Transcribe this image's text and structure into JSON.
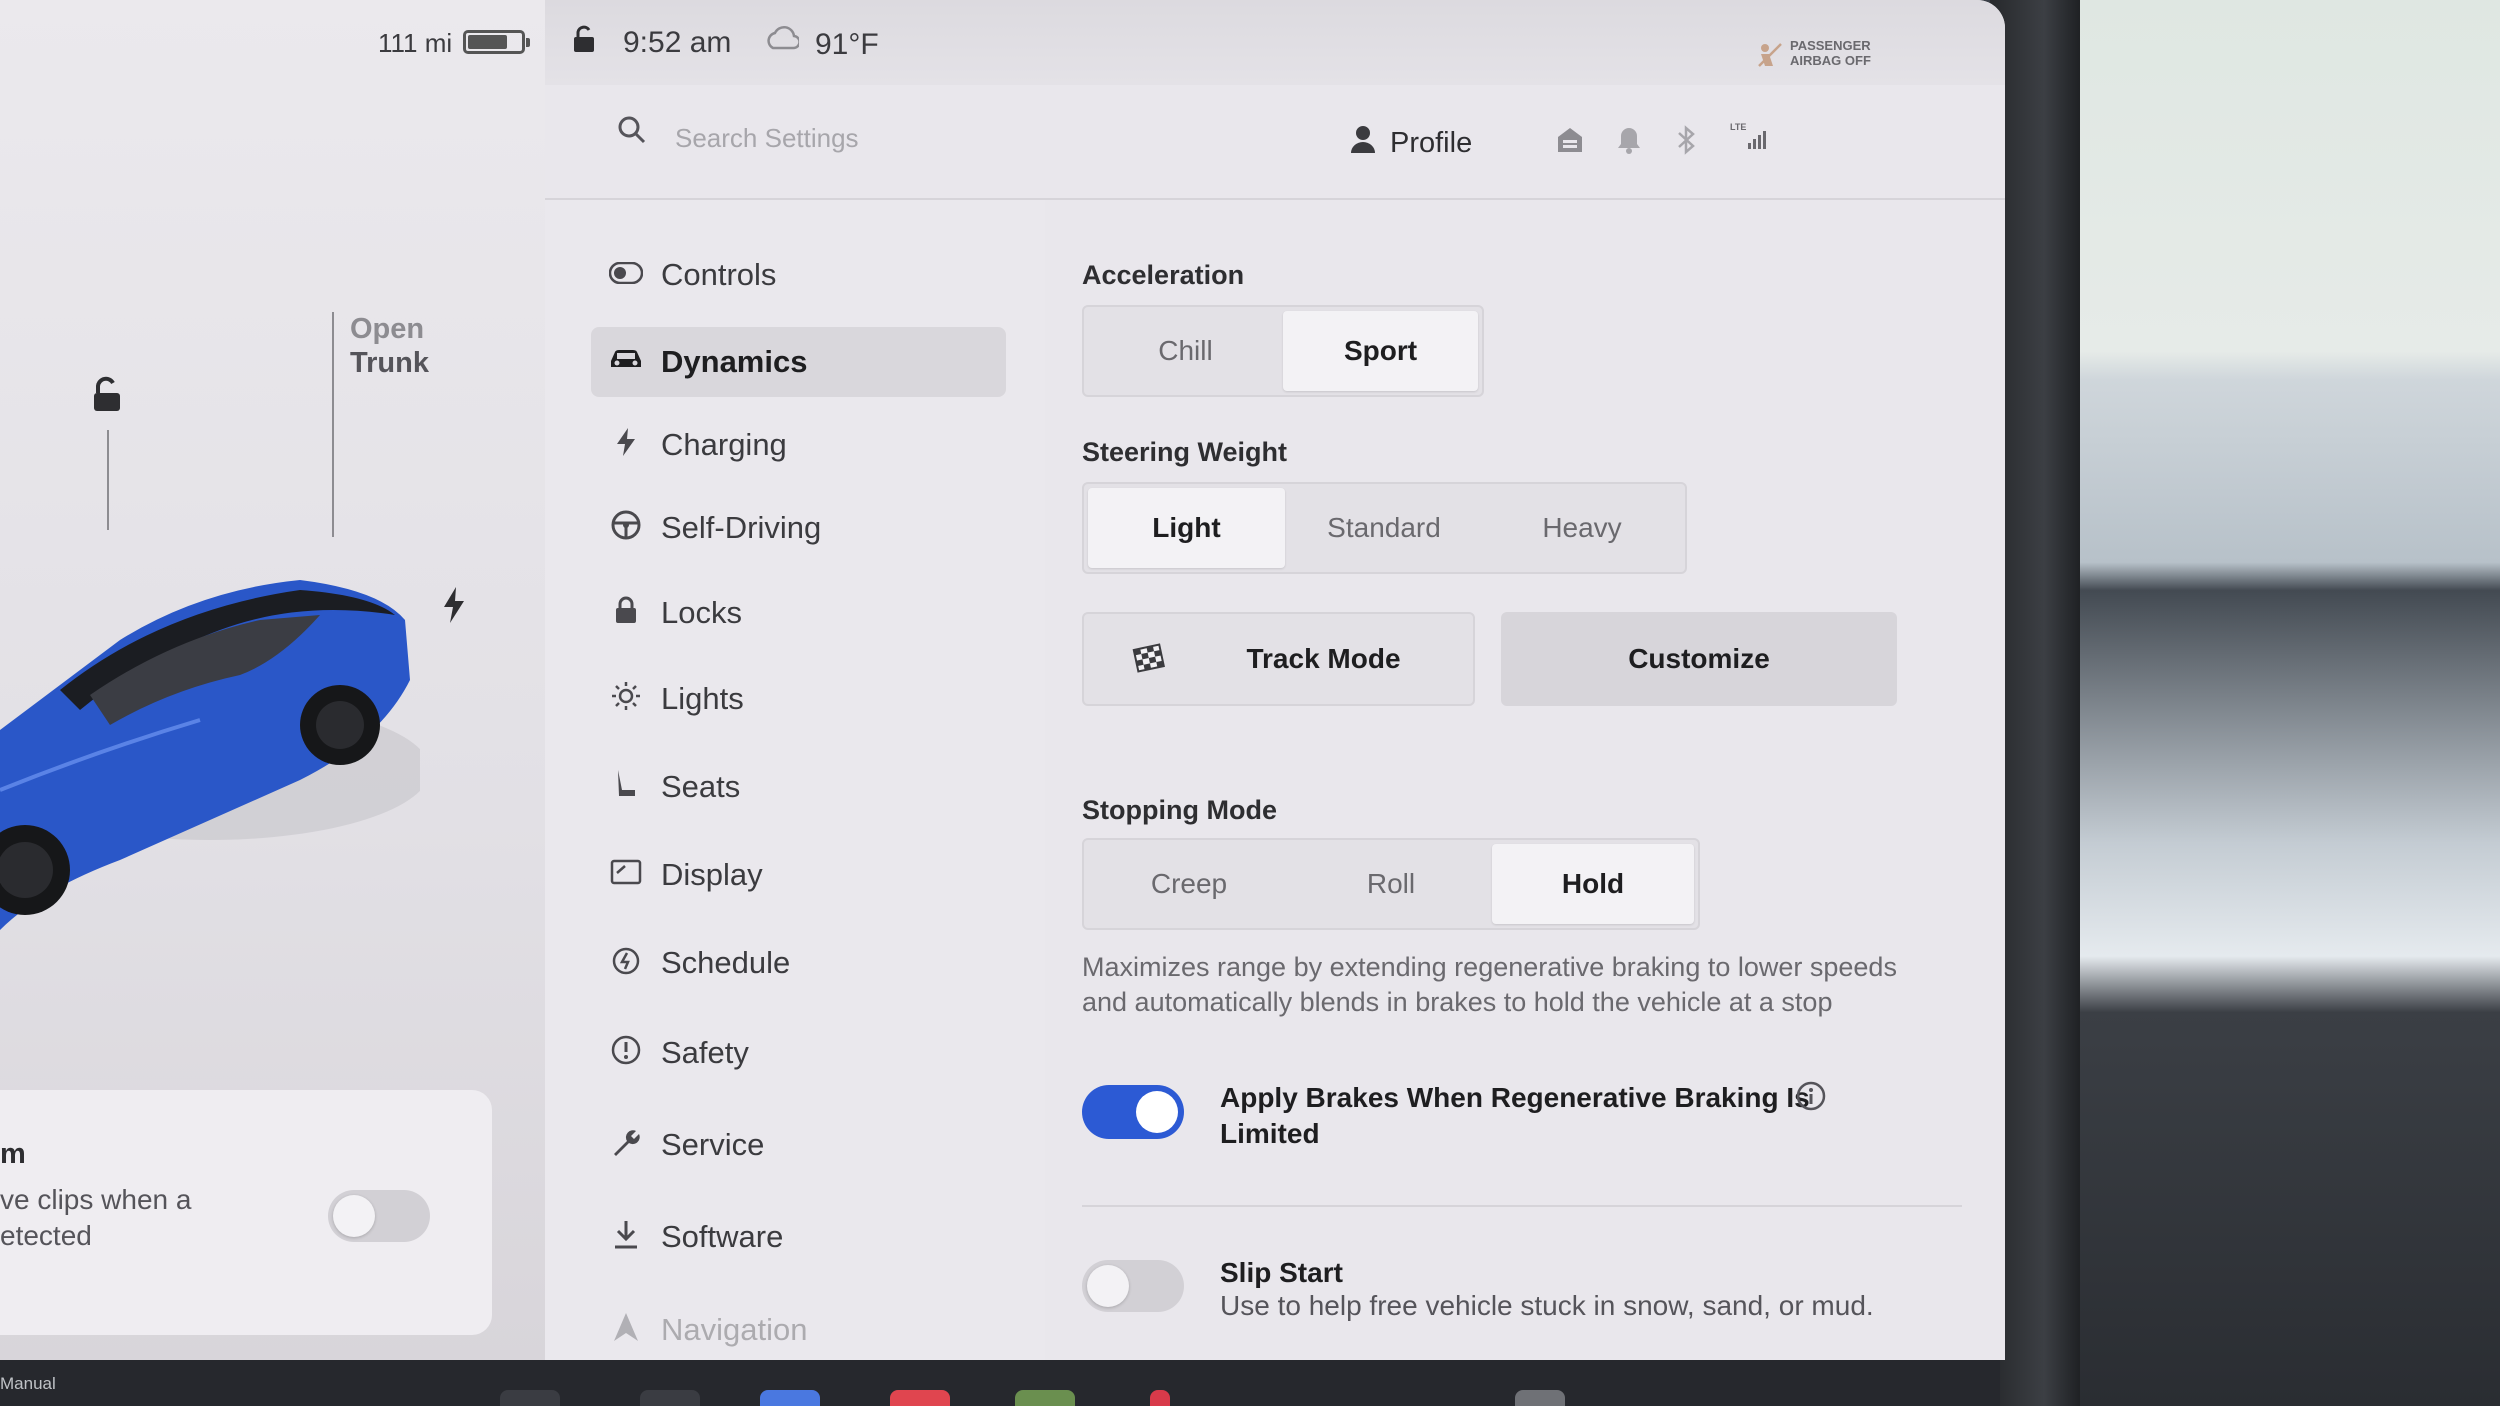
{
  "status": {
    "range": "111 mi",
    "battery_level": 0.75,
    "time": "9:52 am",
    "temperature": "91°F",
    "airbag_line1": "PASSENGER",
    "airbag_line2": "AIRBAG OFF"
  },
  "vehicle": {
    "trunk_line1": "Open",
    "trunk_line2": "Trunk",
    "car_color": "#2a57c8"
  },
  "sentry": {
    "line1": "m",
    "line2": "ve clips when a\netected"
  },
  "header": {
    "search_placeholder": "Search Settings",
    "profile_label": "Profile"
  },
  "sidebar": {
    "items": [
      {
        "label": "Controls",
        "icon": "toggle-icon"
      },
      {
        "label": "Dynamics",
        "icon": "car-icon"
      },
      {
        "label": "Charging",
        "icon": "bolt-icon"
      },
      {
        "label": "Self-Driving",
        "icon": "steering-wheel-icon"
      },
      {
        "label": "Locks",
        "icon": "lock-icon"
      },
      {
        "label": "Lights",
        "icon": "sun-icon"
      },
      {
        "label": "Seats",
        "icon": "seat-icon"
      },
      {
        "label": "Display",
        "icon": "display-icon"
      },
      {
        "label": "Schedule",
        "icon": "clock-icon"
      },
      {
        "label": "Safety",
        "icon": "alert-icon"
      },
      {
        "label": "Service",
        "icon": "wrench-icon"
      },
      {
        "label": "Software",
        "icon": "download-icon"
      },
      {
        "label": "Navigation",
        "icon": "navigation-icon"
      }
    ],
    "active": "Dynamics"
  },
  "main": {
    "acceleration": {
      "title": "Acceleration",
      "options": [
        "Chill",
        "Sport"
      ],
      "selected": "Sport"
    },
    "steering": {
      "title": "Steering Weight",
      "options": [
        "Light",
        "Standard",
        "Heavy"
      ],
      "selected": "Light"
    },
    "track_mode_label": "Track Mode",
    "customize_label": "Customize",
    "stopping": {
      "title": "Stopping Mode",
      "options": [
        "Creep",
        "Roll",
        "Hold"
      ],
      "selected": "Hold"
    },
    "stopping_desc": "Maximizes range by extending regenerative braking to lower speeds and automatically blends in brakes to hold the vehicle at a stop",
    "apply_brakes": {
      "label_line1": "Apply Brakes When Regenerative Braking Is",
      "label_line2": "Limited",
      "enabled": true
    },
    "slip_start": {
      "label": "Slip Start",
      "desc": "Use to help free vehicle stuck in snow, sand, or mud.",
      "enabled": false
    }
  },
  "taskbar": {
    "label": "Manual"
  },
  "colors": {
    "accent": "#2c5ad4",
    "screen_bg": "#e9e7ec"
  }
}
